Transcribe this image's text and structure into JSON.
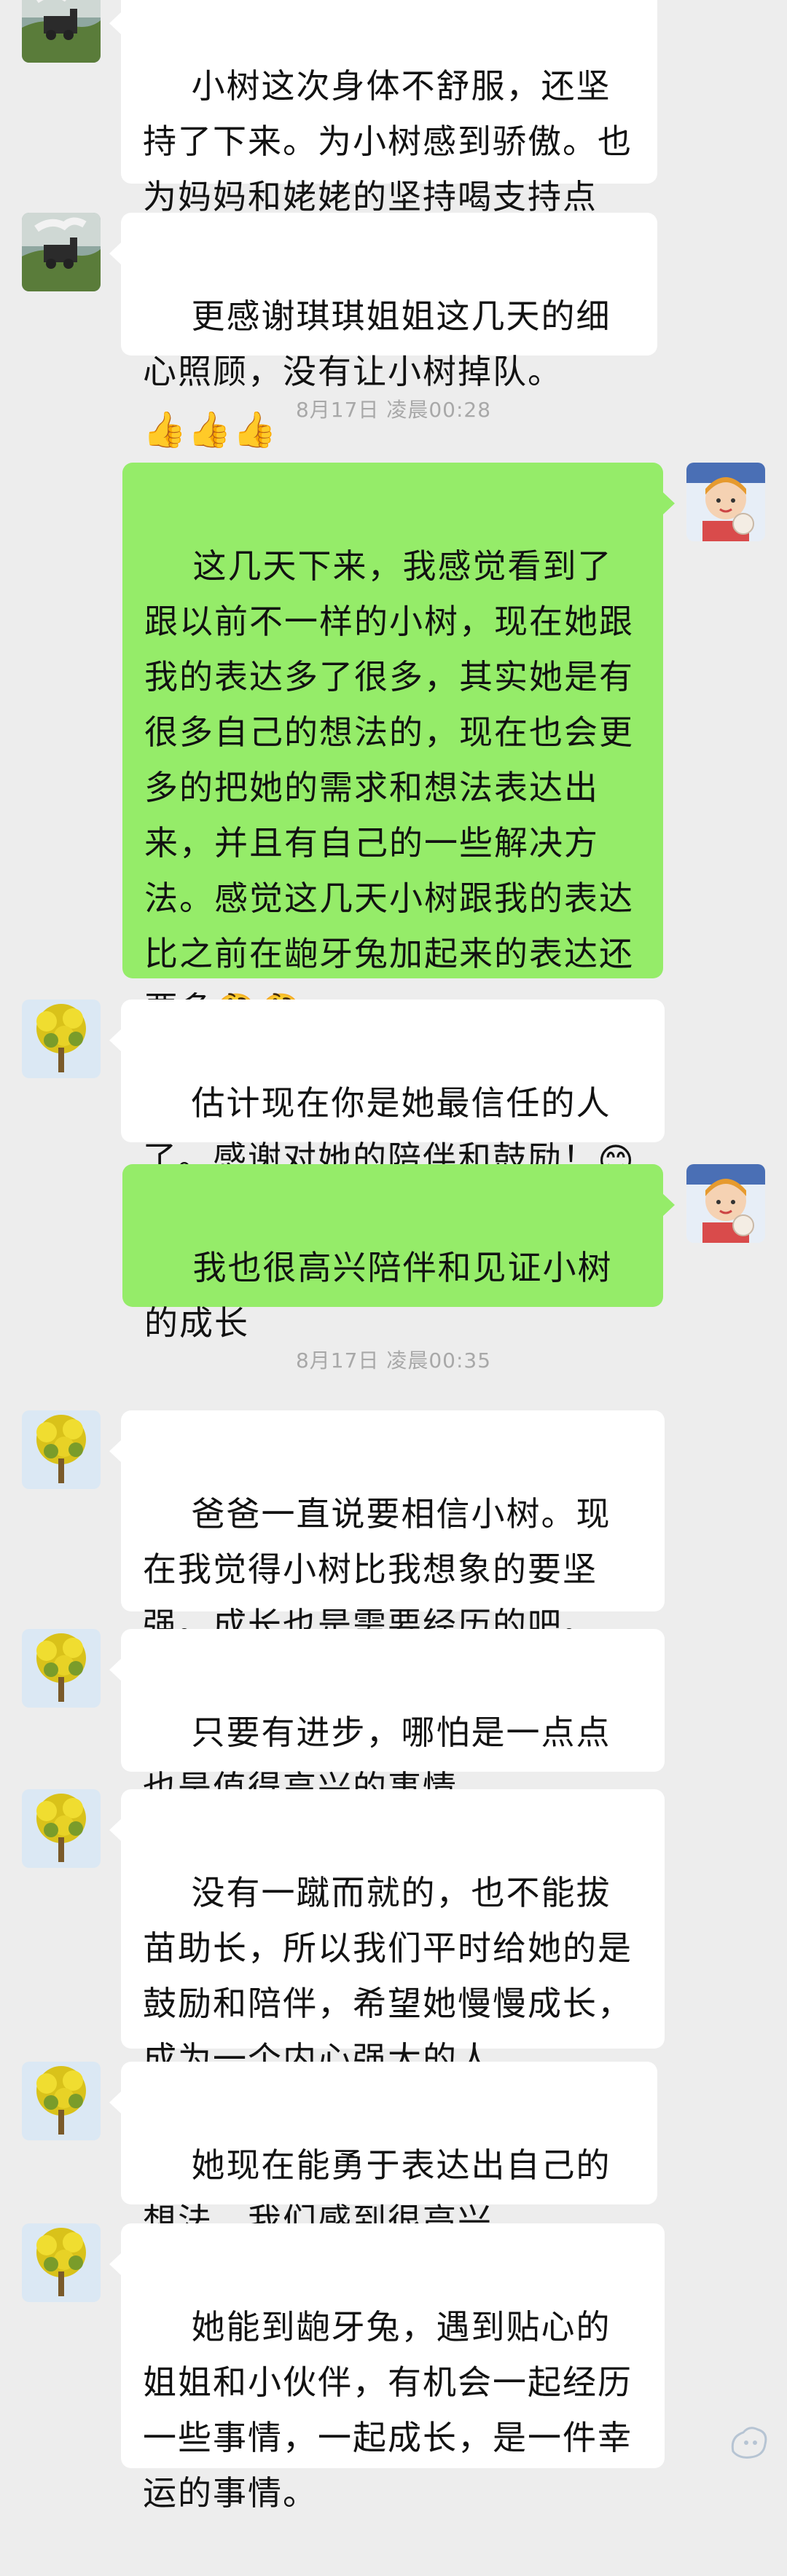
{
  "messages": [
    {
      "side": "left",
      "avatar": "train-avatar",
      "text": "小树这次身体不舒服，还坚持了下来。为小树感到骄傲。也为妈妈和姥姥的坚持喝支持点赞。"
    },
    {
      "side": "left",
      "avatar": "train-avatar",
      "text": "更感谢琪琪姐姐这几天的细心照顾，没有让小树掉队。",
      "emoji": "👍👍👍"
    },
    {
      "timestamp": "8月17日 凌晨00:28"
    },
    {
      "side": "right",
      "avatar": "child-avatar",
      "text": "这几天下来，我感觉看到了跟以前不一样的小树，现在她跟我的表达多了很多，其实她是有很多自己的想法的，现在也会更多的把她的需求和想法表达出来，并且有自己的一些解决方法。感觉这几天小树跟我的表达比之前在龅牙兔加起来的表达还要多",
      "emoji": "🤔🤔"
    },
    {
      "side": "left",
      "avatar": "flower-avatar",
      "text": "估计现在你是她最信任的人了。感谢对她的陪伴和鼓励！",
      "emoji": "😊"
    },
    {
      "side": "right",
      "avatar": "child-avatar",
      "text": "我也很高兴陪伴和见证小树的成长"
    },
    {
      "timestamp": "8月17日 凌晨00:35"
    },
    {
      "side": "left",
      "avatar": "flower-avatar",
      "text": "爸爸一直说要相信小树。现在我觉得小树比我想象的要坚强。成长也是需要经历的吧。"
    },
    {
      "side": "left",
      "avatar": "flower-avatar",
      "text": "只要有进步，哪怕是一点点也是值得高兴的事情。"
    },
    {
      "side": "left",
      "avatar": "flower-avatar",
      "text": "没有一蹴而就的，也不能拔苗助长，所以我们平时给她的是鼓励和陪伴，希望她慢慢成长，成为一个内心强大的人。"
    },
    {
      "side": "left",
      "avatar": "flower-avatar",
      "text": "她现在能勇于表达出自己的想法，我们感到很高兴。"
    },
    {
      "side": "left",
      "avatar": "flower-avatar",
      "text": "她能到龅牙兔，遇到贴心的姐姐和小伙伴，有机会一起经历一些事情，一起成长，是一件幸运的事情。"
    }
  ],
  "colors": {
    "background": "#ededed",
    "bubble_left": "#ffffff",
    "bubble_right": "#95ec69",
    "timestamp_text": "#a8a8a8"
  }
}
